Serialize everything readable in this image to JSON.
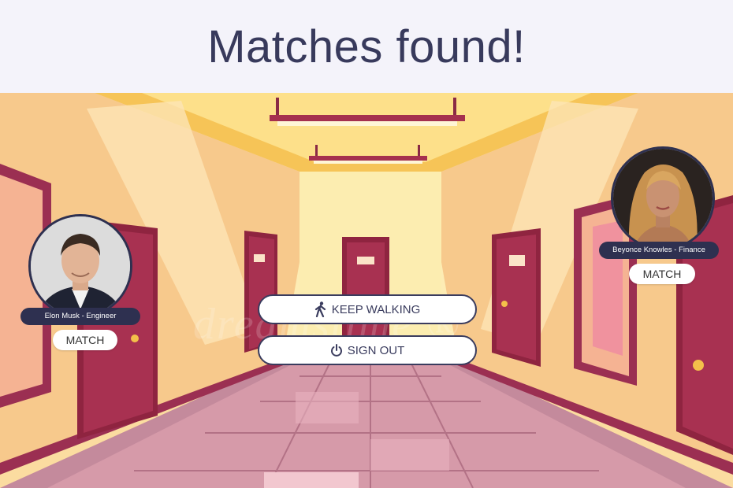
{
  "header": {
    "title": "Matches found!"
  },
  "matches": [
    {
      "name_label": "Elon Musk - Engineer",
      "match_label": "MATCH"
    },
    {
      "name_label": "Beyonce Knowles - Finance",
      "match_label": "MATCH"
    }
  ],
  "actions": {
    "keep_walking_label": "KEEP WALKING",
    "sign_out_label": "SIGN OUT"
  },
  "icons": {
    "keep_walking": "walking-person-icon",
    "sign_out": "power-icon"
  },
  "colors": {
    "header_text": "#383a5c",
    "header_bg": "#f4f3fa",
    "pill_bg": "#2e3050",
    "button_border": "#3a3c5e"
  }
}
